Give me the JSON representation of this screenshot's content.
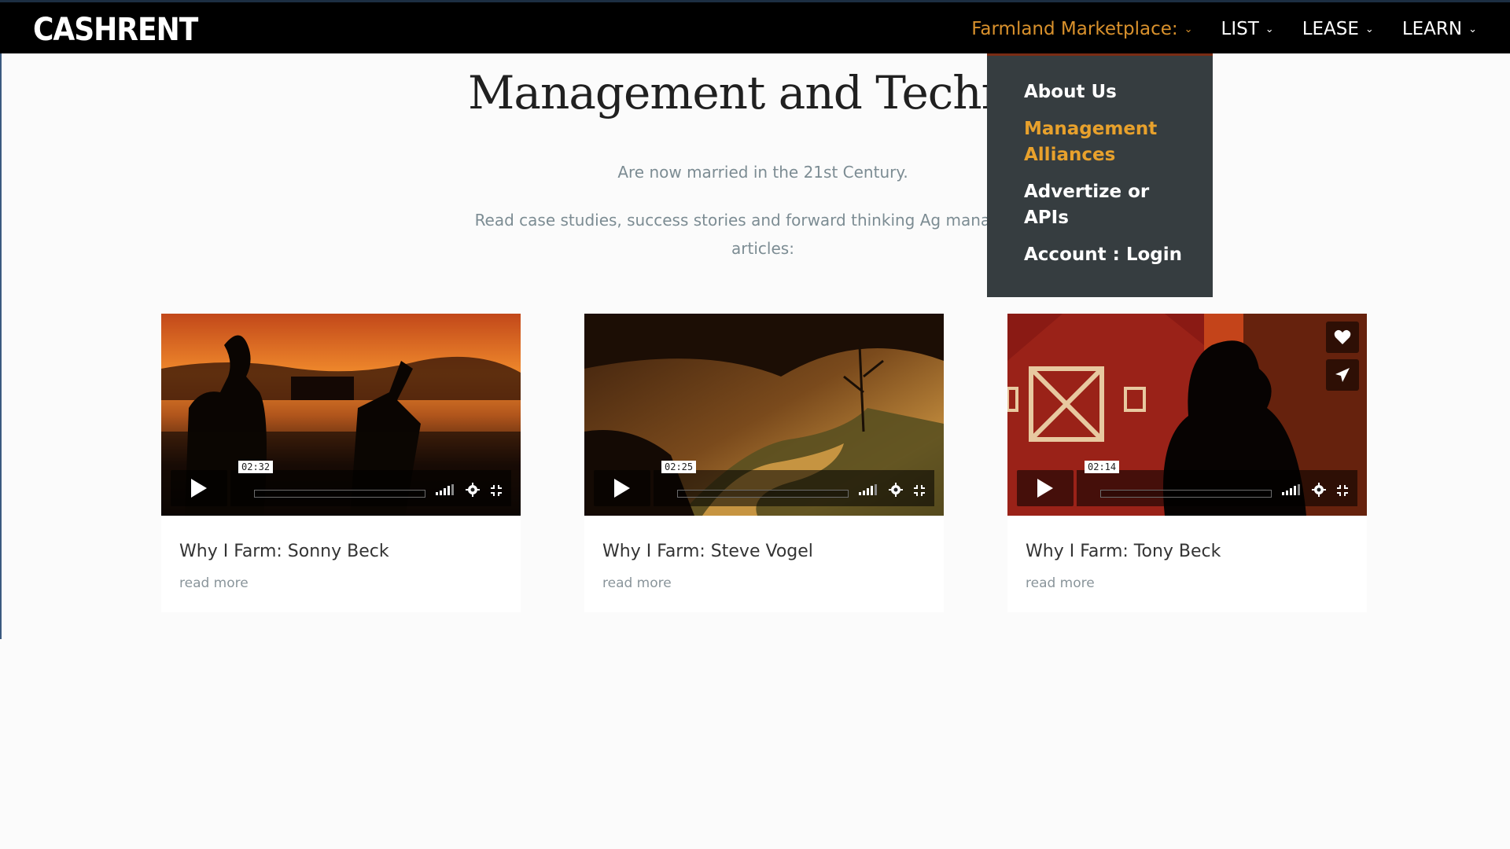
{
  "header": {
    "logo": "CASHRENT",
    "nav": [
      {
        "label": "Farmland Marketplace:",
        "active": true
      },
      {
        "label": "LIST",
        "active": false
      },
      {
        "label": "LEASE",
        "active": false
      },
      {
        "label": "LEARN",
        "active": false
      }
    ]
  },
  "dropdown": {
    "items": [
      {
        "label": "About Us",
        "active": false
      },
      {
        "label": "Management Alliances",
        "active": true
      },
      {
        "label": "Advertize or APIs",
        "active": false
      },
      {
        "label": "Account : Login",
        "active": false
      }
    ]
  },
  "hero": {
    "title": "Management and Technology",
    "subtitle": "Are now married in the 21st Century.",
    "description": "Read case studies, success stories and forward thinking Ag management articles:"
  },
  "cards": [
    {
      "title": "Why I Farm: Sonny Beck",
      "time": "02:32",
      "read_more": "read more"
    },
    {
      "title": "Why I Farm: Steve Vogel",
      "time": "02:25",
      "read_more": "read more"
    },
    {
      "title": "Why I Farm: Tony Beck",
      "time": "02:14",
      "read_more": "read more"
    }
  ],
  "colors": {
    "accent": "#d9912c",
    "dropdown_bg": "#363d40",
    "header_bg": "#000000",
    "muted_text": "#7c8c93"
  }
}
